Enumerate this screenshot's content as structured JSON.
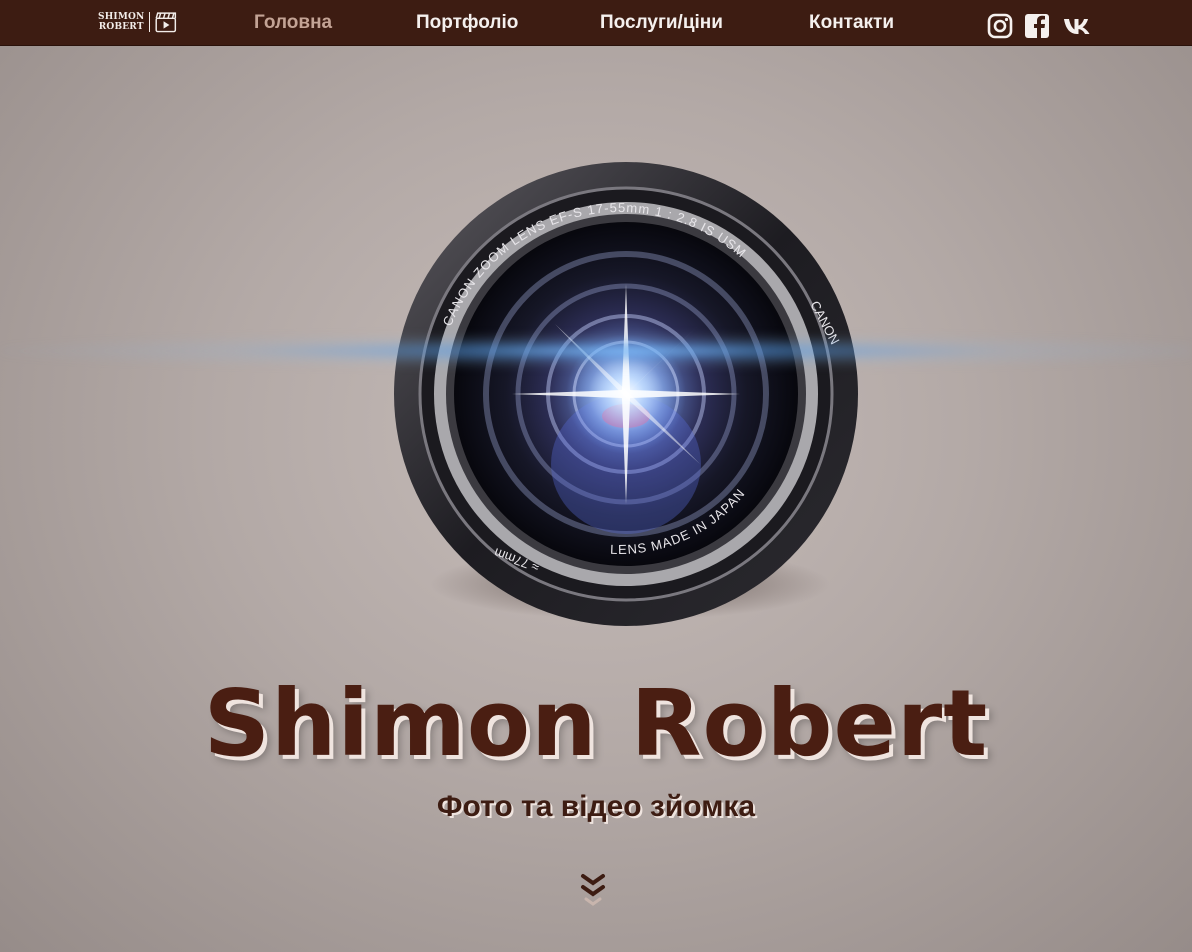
{
  "logo": {
    "line1": "SHIMON",
    "line2": "ROBERT"
  },
  "nav": {
    "items": [
      {
        "label": "Головна",
        "active": true
      },
      {
        "label": "Портфоліо",
        "active": false
      },
      {
        "label": "Послуги/ціни",
        "active": false
      },
      {
        "label": "Контакти",
        "active": false
      }
    ],
    "social": [
      "instagram-icon",
      "facebook-icon",
      "vk-icon"
    ]
  },
  "lens": {
    "text_top": "CANON  ZOOM  LENS    EF-S    17-55mm    1 : 2.8    IS    USM",
    "text_right": "CANON",
    "text_bottom": "LENS MADE IN JAPAN",
    "text_bottom_left": "≈ 77mm"
  },
  "hero": {
    "title": "Shimon Robert",
    "subtitle": "Фото та відео зйомка"
  },
  "colors": {
    "nav_bg": "#3d1c12",
    "active_nav": "#c3a395",
    "title": "#4a1e12"
  }
}
